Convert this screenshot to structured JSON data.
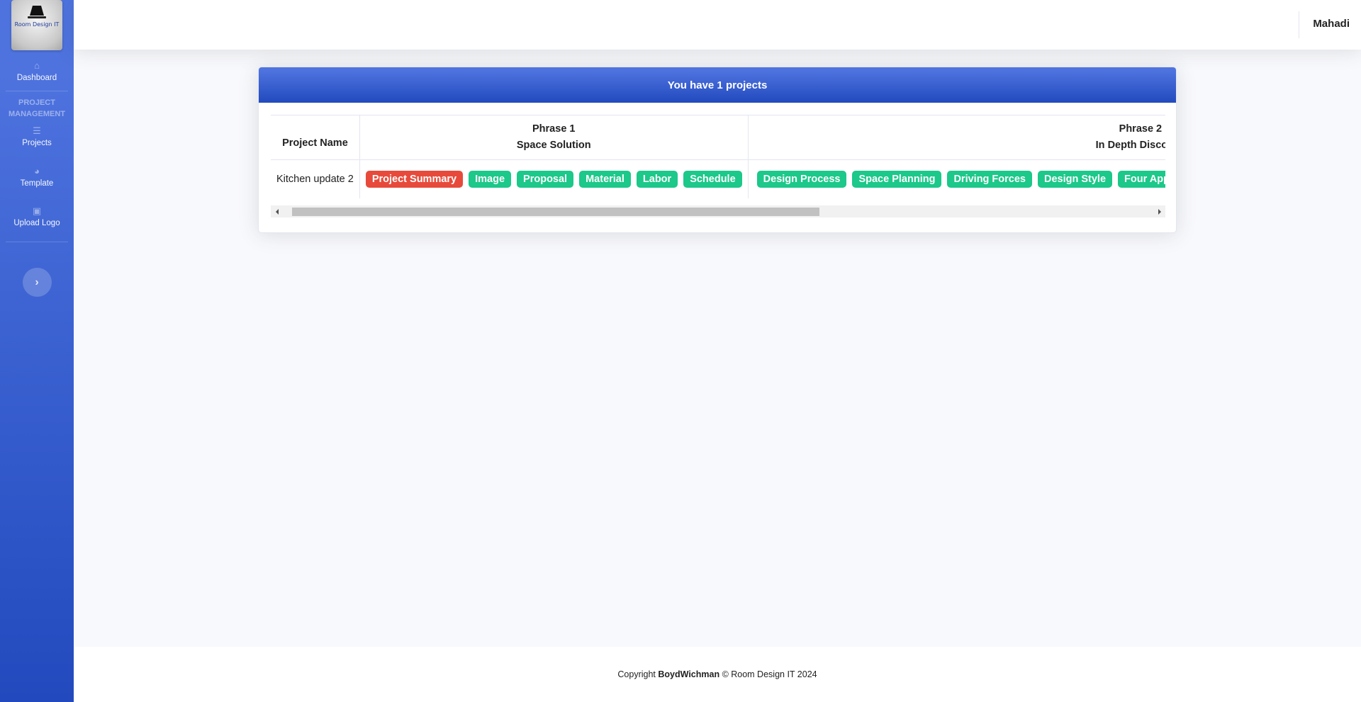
{
  "sidebar": {
    "brand": {
      "text": "Room Design IT"
    },
    "items": [
      {
        "label": "Dashboard",
        "icon": "home-icon"
      },
      {
        "label": "Projects",
        "icon": "list-icon"
      },
      {
        "label": "Template",
        "icon": "gauge-icon"
      },
      {
        "label": "Upload Logo",
        "icon": "image-icon"
      }
    ],
    "heading": "PROJECT MANAGEMENT",
    "toggle_icon": "chevron-right-icon"
  },
  "topbar": {
    "user_name": "Mahadi"
  },
  "card": {
    "title": "You have 1 projects",
    "table": {
      "headers": {
        "project_name": "Project Name",
        "phase1_line1": "Phrase 1",
        "phase1_line2": "Space Solution",
        "phase2_line1": "Phrase 2",
        "phase2_line2": "In Depth Discover"
      },
      "rows": [
        {
          "name": "Kitchen update 2",
          "phase1": [
            "Project Summary",
            "Image",
            "Proposal",
            "Material",
            "Labor",
            "Schedule"
          ],
          "phase2": [
            "Design Process",
            "Space Planning",
            "Driving Forces",
            "Design Style",
            "Four Approach"
          ]
        }
      ]
    }
  },
  "footer": {
    "prefix": "Copyright",
    "author": "BoydWichman",
    "suffix": "© Room Design IT 2024"
  },
  "colors": {
    "sidebar_gradient_start": "#4e73df",
    "sidebar_gradient_end": "#224abe",
    "badge_active": "#e74a3b",
    "badge_default": "#1cc88a"
  }
}
